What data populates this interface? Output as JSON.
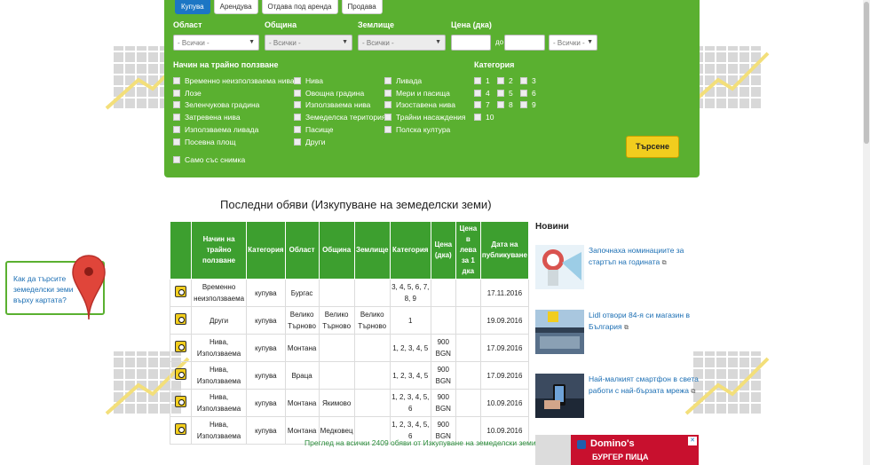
{
  "tabs": [
    "Купува",
    "Арендува",
    "Отдава под аренда",
    "Продава"
  ],
  "filters": {
    "region_label": "Област",
    "region_value": "- Всички -",
    "municipality_label": "Община",
    "municipality_value": "- Всички -",
    "land_label": "Землище",
    "land_value": "- Всички -",
    "price_label": "Цена (дка)",
    "price_to": "до",
    "currency_value": "- Всички -",
    "usage_label": "Начин на трайно ползване",
    "usage_col1": [
      "Временно неизползваема нива",
      "Лозе",
      "Зеленчукова градина",
      "Затревена нива",
      "Използваема ливада",
      "Посевна площ"
    ],
    "usage_col2": [
      "Нива",
      "Овощна градина",
      "Използваема нива",
      "Земеделска територия",
      "Пасище",
      "Други"
    ],
    "usage_col3": [
      "Ливада",
      "Мери и пасища",
      "Изоставена нива",
      "Трайни насаждения",
      "Полска култура"
    ],
    "category_label": "Категория",
    "categories": [
      "1",
      "2",
      "3",
      "4",
      "5",
      "6",
      "7",
      "8",
      "9",
      "10"
    ],
    "photo_only": "Само със снимка",
    "search_button": "Търсене"
  },
  "listing": {
    "heading": "Последни обяви (Изкупуване на земеделски земи)",
    "headers": [
      "Начин на трайно ползване",
      "Категория",
      "Област",
      "Община",
      "Землище",
      "Категория",
      "Цена (дка)",
      "Цена в лева за 1 дка",
      "Дата на публикуване"
    ],
    "rows": [
      {
        "usage": "Временно неизползваема",
        "category": "купува",
        "region": "Бургас",
        "municipality": "",
        "land": "",
        "cats": "3, 4, 5, 6, 7, 8, 9",
        "price": "",
        "price_lv": "",
        "date": "17.11.2016"
      },
      {
        "usage": "Други",
        "category": "купува",
        "region": "Велико Търново",
        "municipality": "Велико Търново",
        "land": "Велико Търново",
        "cats": "1",
        "price": "",
        "price_lv": "",
        "date": "19.09.2016"
      },
      {
        "usage": "Нива, Използваема",
        "category": "купува",
        "region": "Монтана",
        "municipality": "",
        "land": "",
        "cats": "1, 2, 3, 4, 5",
        "price": "900 BGN",
        "price_lv": "",
        "date": "17.09.2016"
      },
      {
        "usage": "Нива, Използваема",
        "category": "купува",
        "region": "Враца",
        "municipality": "",
        "land": "",
        "cats": "1, 2, 3, 4, 5",
        "price": "900 BGN",
        "price_lv": "",
        "date": "17.09.2016"
      },
      {
        "usage": "Нива, Използваема",
        "category": "купува",
        "region": "Монтана",
        "municipality": "Якимово",
        "land": "",
        "cats": "1, 2, 3, 4, 5, 6",
        "price": "900 BGN",
        "price_lv": "",
        "date": "10.09.2016"
      },
      {
        "usage": "Нива, Използваема",
        "category": "купува",
        "region": "Монтана",
        "municipality": "Медковец",
        "land": "",
        "cats": "1, 2, 3, 4, 5, 6",
        "price": "900 BGN",
        "price_lv": "",
        "date": "10.09.2016"
      }
    ],
    "all_link": "Преглед на всички 2409 обяви от Изкупуване на земеделски земи"
  },
  "map_hint": "Как да търсите земеделски земи върху картата?",
  "news": {
    "title": "Новини",
    "items": [
      {
        "text": "Започнаха номинациите за стартъп на годината"
      },
      {
        "text": "Lidl отвори 84-я си магазин в България"
      },
      {
        "text": "Най-малкият смартфон в света работи с най-бързата мрежа"
      }
    ]
  },
  "ad": {
    "brand": "Domino's",
    "tagline": "БУРГЕР ПИЦА"
  },
  "colors": {
    "panel_green": "#5ab030",
    "header_green": "#3d9f2f",
    "accent_yellow": "#f1cd1e",
    "tab_blue": "#1c76c4",
    "link_blue": "#1c6fb4"
  }
}
